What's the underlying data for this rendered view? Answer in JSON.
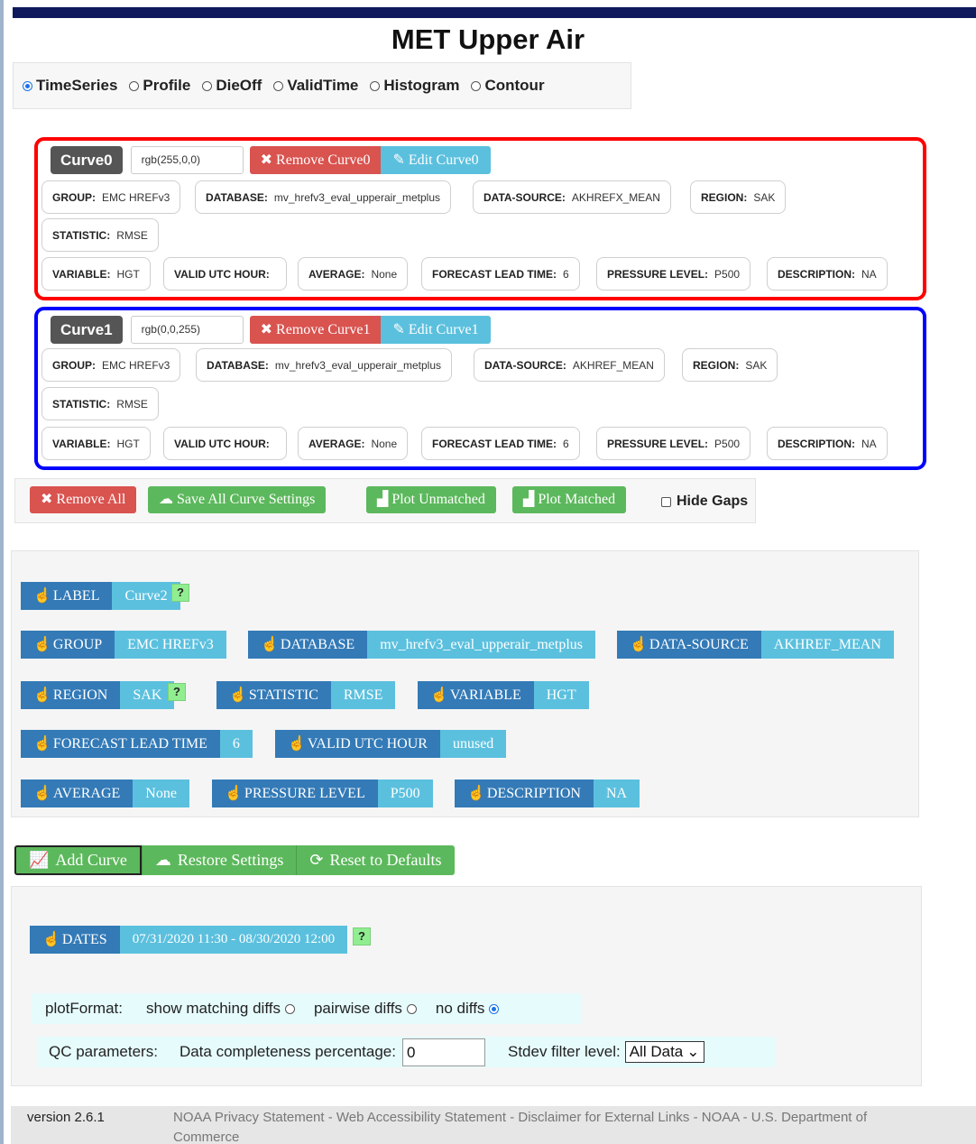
{
  "app": {
    "title": "MET Upper Air"
  },
  "plot_types": [
    {
      "label": "TimeSeries",
      "selected": true
    },
    {
      "label": "Profile",
      "selected": false
    },
    {
      "label": "DieOff",
      "selected": false
    },
    {
      "label": "ValidTime",
      "selected": false
    },
    {
      "label": "Histogram",
      "selected": false
    },
    {
      "label": "Contour",
      "selected": false
    }
  ],
  "curves": [
    {
      "name": "Curve0",
      "color_text": "rgb(255,0,0)",
      "border_color": "#ff0000",
      "remove_label": "Remove Curve0",
      "edit_label": "Edit Curve0",
      "fields": {
        "group": {
          "k": "GROUP:",
          "v": "EMC HREFv3"
        },
        "database": {
          "k": "DATABASE:",
          "v": "mv_hrefv3_eval_upperair_metplus"
        },
        "data_source": {
          "k": "DATA-SOURCE:",
          "v": "AKHREFX_MEAN"
        },
        "region": {
          "k": "REGION:",
          "v": "SAK"
        },
        "statistic": {
          "k": "STATISTIC:",
          "v": "RMSE"
        },
        "variable": {
          "k": "VARIABLE:",
          "v": "HGT"
        },
        "valid_utc_hour": {
          "k": "VALID UTC HOUR:",
          "v": ""
        },
        "average": {
          "k": "AVERAGE:",
          "v": "None"
        },
        "forecast_lead_time": {
          "k": "FORECAST LEAD TIME:",
          "v": "6"
        },
        "pressure_level": {
          "k": "PRESSURE LEVEL:",
          "v": "P500"
        },
        "description": {
          "k": "DESCRIPTION:",
          "v": "NA"
        }
      }
    },
    {
      "name": "Curve1",
      "color_text": "rgb(0,0,255)",
      "border_color": "#0000ff",
      "remove_label": "Remove Curve1",
      "edit_label": "Edit Curve1",
      "fields": {
        "group": {
          "k": "GROUP:",
          "v": "EMC HREFv3"
        },
        "database": {
          "k": "DATABASE:",
          "v": "mv_hrefv3_eval_upperair_metplus"
        },
        "data_source": {
          "k": "DATA-SOURCE:",
          "v": "AKHREF_MEAN"
        },
        "region": {
          "k": "REGION:",
          "v": "SAK"
        },
        "statistic": {
          "k": "STATISTIC:",
          "v": "RMSE"
        },
        "variable": {
          "k": "VARIABLE:",
          "v": "HGT"
        },
        "valid_utc_hour": {
          "k": "VALID UTC HOUR:",
          "v": ""
        },
        "average": {
          "k": "AVERAGE:",
          "v": "None"
        },
        "forecast_lead_time": {
          "k": "FORECAST LEAD TIME:",
          "v": "6"
        },
        "pressure_level": {
          "k": "PRESSURE LEVEL:",
          "v": "P500"
        },
        "description": {
          "k": "DESCRIPTION:",
          "v": "NA"
        }
      }
    }
  ],
  "actions": {
    "remove_all": "Remove All",
    "save_all": "Save All Curve Settings",
    "plot_unmatched": "Plot Unmatched",
    "plot_matched": "Plot Matched",
    "hide_gaps": "Hide Gaps",
    "hide_gaps_checked": false
  },
  "selectors": {
    "label": {
      "k": "LABEL",
      "v": "Curve2"
    },
    "group": {
      "k": "GROUP",
      "v": "EMC HREFv3"
    },
    "database": {
      "k": "DATABASE",
      "v": "mv_hrefv3_eval_upperair_metplus"
    },
    "data_source": {
      "k": "DATA-SOURCE",
      "v": "AKHREF_MEAN"
    },
    "region": {
      "k": "REGION",
      "v": "SAK"
    },
    "statistic": {
      "k": "STATISTIC",
      "v": "RMSE"
    },
    "variable": {
      "k": "VARIABLE",
      "v": "HGT"
    },
    "forecast_lead_time": {
      "k": "FORECAST LEAD TIME",
      "v": "6"
    },
    "valid_utc_hour": {
      "k": "VALID UTC HOUR",
      "v": "unused"
    },
    "average": {
      "k": "AVERAGE",
      "v": "None"
    },
    "pressure_level": {
      "k": "PRESSURE LEVEL",
      "v": "P500"
    },
    "description": {
      "k": "DESCRIPTION",
      "v": "NA"
    },
    "help_text": "?"
  },
  "curve_actions": {
    "add_curve": "Add Curve",
    "restore_settings": "Restore Settings",
    "reset_defaults": "Reset to Defaults"
  },
  "dates": {
    "k": "DATES",
    "v": "07/31/2020 11:30 - 08/30/2020 12:00"
  },
  "plot_format": {
    "label": "plotFormat:",
    "options": [
      {
        "label": "show matching diffs",
        "selected": false
      },
      {
        "label": "pairwise diffs",
        "selected": false
      },
      {
        "label": "no diffs",
        "selected": true
      }
    ]
  },
  "qc": {
    "label": "QC parameters:",
    "completeness_label": "Data completeness percentage:",
    "completeness_value": "0",
    "stdev_label": "Stdev filter level:",
    "stdev_value": "All Data"
  },
  "footer": {
    "version": "version 2.6.1",
    "links": "NOAA Privacy Statement - Web Accessibility Statement - Disclaimer for External Links - NOAA - U.S. Department of Commerce"
  }
}
